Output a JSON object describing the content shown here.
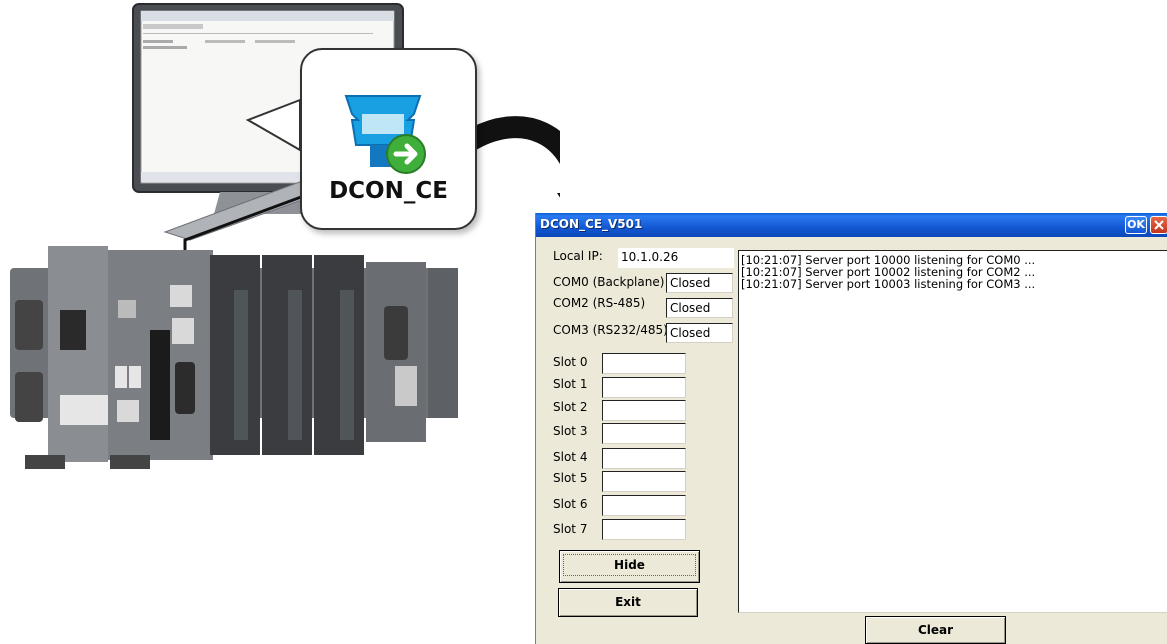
{
  "callout": {
    "label": "DCON_CE"
  },
  "window": {
    "title": "DCON_CE_V501",
    "ok_label": "OK",
    "local_ip_label": "Local IP:",
    "local_ip_value": "10.1.0.26",
    "ports": [
      {
        "label": "COM0 (Backplane)",
        "status": "Closed"
      },
      {
        "label": "COM2 (RS-485)",
        "status": "Closed"
      },
      {
        "label": "COM3 (RS232/485)",
        "status": "Closed"
      }
    ],
    "slots": [
      "Slot 0",
      "Slot 1",
      "Slot 2",
      "Slot 3",
      "Slot 4",
      "Slot 5",
      "Slot 6",
      "Slot 7"
    ],
    "log": [
      "[10:21:07] Server port 10000 listening for COM0 ...",
      "[10:21:07] Server port 10002 listening for COM2 ...",
      "[10:21:07] Server port 10003 listening for COM3 ..."
    ],
    "hide_label": "Hide",
    "exit_label": "Exit",
    "clear_label": "Clear"
  }
}
